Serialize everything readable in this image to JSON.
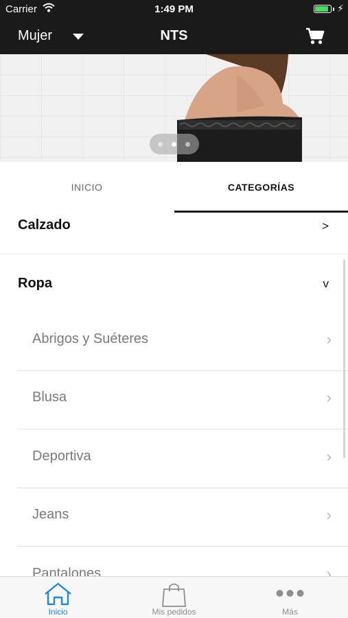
{
  "status_bar": {
    "carrier": "Carrier",
    "time": "1:49 PM",
    "battery_level": 0.85
  },
  "nav_bar": {
    "department": "Mujer",
    "title": "NTS",
    "icons": {
      "department_dropdown": "caret-down-icon",
      "cart": "shopping-cart-icon"
    }
  },
  "banner": {
    "pager_dots": 3,
    "active_dot": 2
  },
  "tabs": [
    {
      "label": "INICIO",
      "active": false
    },
    {
      "label": "CATEGORÍAS",
      "active": true
    }
  ],
  "categories": [
    {
      "name": "Calzado",
      "indicator": ">"
    },
    {
      "name": "Ropa",
      "indicator": "v"
    }
  ],
  "subcategories": [
    {
      "label": "Abrigos y Suéteres"
    },
    {
      "label": "Blusa"
    },
    {
      "label": "Deportiva"
    },
    {
      "label": "Jeans"
    },
    {
      "label": "Pantalones"
    }
  ],
  "bottom_tabs": [
    {
      "label": "Inicio",
      "icon": "home-icon",
      "active": true
    },
    {
      "label": "Mis pedidos",
      "icon": "shopping-bag-icon",
      "active": false
    },
    {
      "label": "Más",
      "icon": "more-dots-icon",
      "active": false
    }
  ],
  "colors": {
    "header_bg": "#1a1a1a",
    "accent_blue": "#1e88e5",
    "battery_green": "#4cd964"
  }
}
